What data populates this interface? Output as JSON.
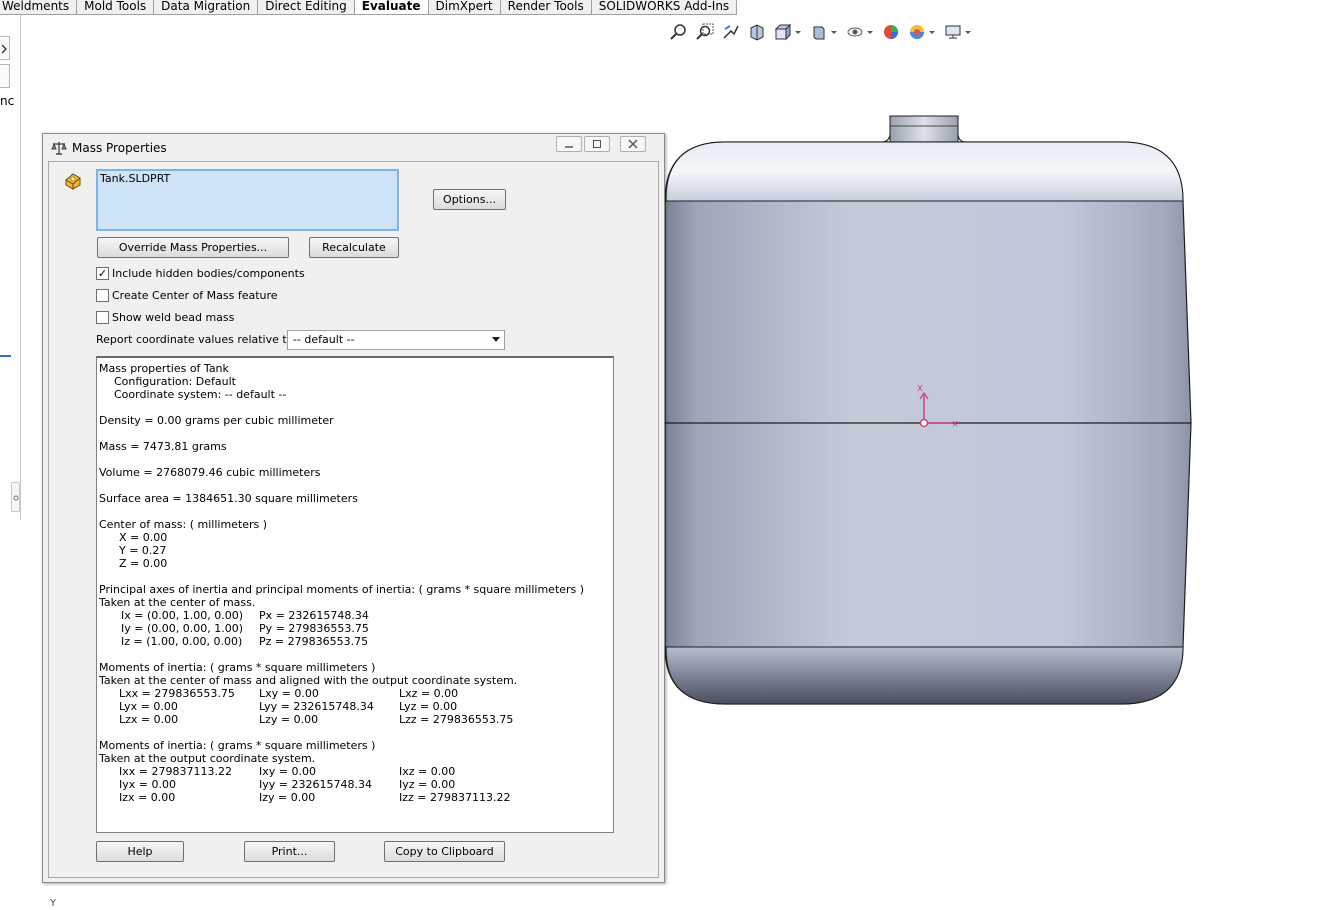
{
  "command_tabs": [
    "Weldments",
    "Mold Tools",
    "Data Migration",
    "Direct Editing",
    "Evaluate",
    "DimXpert",
    "Render Tools",
    "SOLIDWORKS Add-Ins"
  ],
  "active_tab": "Evaluate",
  "hud_icons": [
    "zoom-to-fit-icon",
    "zoom-to-area-icon",
    "previous-view-icon",
    "section-view-icon",
    "view-orientation-icon",
    "display-style-icon",
    "hide-show-items-icon",
    "edit-appearance-icon",
    "apply-scene-icon",
    "view-settings-icon"
  ],
  "left_panel_text": "nc",
  "triad_label": "Y",
  "dialog": {
    "title": "Mass Properties",
    "selected_item": "Tank.SLDPRT",
    "options_label": "Options...",
    "override_label": "Override Mass Properties...",
    "recalculate_label": "Recalculate",
    "include_hidden_label": "Include hidden bodies/components",
    "include_hidden_checked": true,
    "create_com_label": "Create Center of Mass feature",
    "create_com_checked": false,
    "show_weld_label": "Show weld bead mass",
    "show_weld_checked": false,
    "report_coord_label": "Report coordinate values relative to:",
    "report_coord_value": "-- default --",
    "help_label": "Help",
    "print_label": "Print...",
    "copy_label": "Copy to Clipboard"
  },
  "results": {
    "lines": [
      {
        "c": [
          "Mass properties of Tank"
        ]
      },
      {
        "c": [
          "Configuration: Default"
        ],
        "i": 1
      },
      {
        "c": [
          "Coordinate system: -- default --"
        ],
        "i": 1
      },
      {
        "c": [
          ""
        ]
      },
      {
        "c": [
          "Density = 0.00 grams per cubic millimeter"
        ]
      },
      {
        "c": [
          ""
        ]
      },
      {
        "c": [
          "Mass = 7473.81 grams"
        ]
      },
      {
        "c": [
          ""
        ]
      },
      {
        "c": [
          "Volume = 2768079.46 cubic millimeters"
        ]
      },
      {
        "c": [
          ""
        ]
      },
      {
        "c": [
          "Surface area = 1384651.30  square millimeters"
        ]
      },
      {
        "c": [
          ""
        ]
      },
      {
        "c": [
          "Center of mass: ( millimeters )"
        ]
      },
      {
        "c": [
          "X = 0.00"
        ],
        "i": 2
      },
      {
        "c": [
          "Y = 0.27"
        ],
        "i": 2
      },
      {
        "c": [
          "Z = 0.00"
        ],
        "i": 2
      },
      {
        "c": [
          ""
        ]
      },
      {
        "c": [
          "Principal axes of inertia and principal moments of inertia: ( grams *  square millimeters )"
        ]
      },
      {
        "c": [
          "Taken at the center of mass."
        ]
      },
      {
        "c": [
          "Ix = (0.00,  1.00,  0.00)",
          "Px = 232615748.34"
        ],
        "t": "p"
      },
      {
        "c": [
          "Iy = (0.00,  0.00,  1.00)",
          "Py = 279836553.75"
        ],
        "t": "p"
      },
      {
        "c": [
          "Iz = (1.00,  0.00,  0.00)",
          "Pz = 279836553.75"
        ],
        "t": "p"
      },
      {
        "c": [
          ""
        ]
      },
      {
        "c": [
          "Moments of inertia: ( grams *  square millimeters )"
        ]
      },
      {
        "c": [
          "Taken at the center of mass and aligned with the output coordinate system."
        ]
      },
      {
        "c": [
          "Lxx = 279836553.75",
          "Lxy = 0.00",
          "Lxz = 0.00"
        ],
        "t": "m"
      },
      {
        "c": [
          "Lyx = 0.00",
          "Lyy = 232615748.34",
          "Lyz = 0.00"
        ],
        "t": "m"
      },
      {
        "c": [
          "Lzx = 0.00",
          "Lzy = 0.00",
          "Lzz = 279836553.75"
        ],
        "t": "m"
      },
      {
        "c": [
          ""
        ]
      },
      {
        "c": [
          "Moments of inertia: ( grams *  square millimeters )"
        ]
      },
      {
        "c": [
          "Taken at the output coordinate system."
        ]
      },
      {
        "c": [
          "Ixx = 279837113.22",
          "Ixy = 0.00",
          "Ixz = 0.00"
        ],
        "t": "m"
      },
      {
        "c": [
          "Iyx = 0.00",
          "Iyy = 232615748.34",
          "Iyz = 0.00"
        ],
        "t": "m"
      },
      {
        "c": [
          "Izx = 0.00",
          "Izy = 0.00",
          "Izz = 279837113.22"
        ],
        "t": "m"
      }
    ]
  },
  "model": {
    "name": "Tank",
    "body_color": "#c6ccdc",
    "edge_color": "#1e1e1e",
    "triad_color": "#d0407a"
  }
}
